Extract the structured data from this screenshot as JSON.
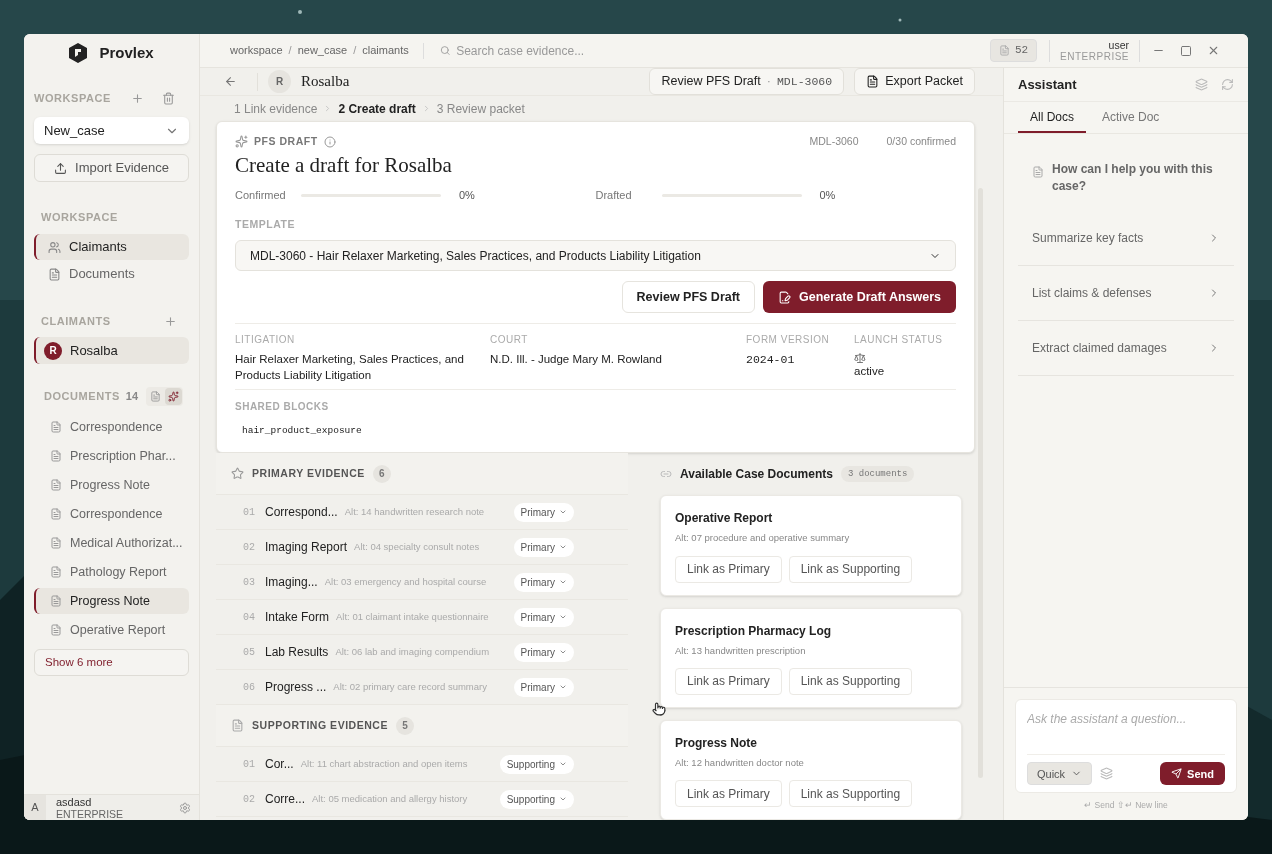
{
  "app": {
    "name": "Provlex"
  },
  "sidebar": {
    "workspace_heading": "WORKSPACE",
    "workspace_select": "New_case",
    "import_button": "Import Evidence",
    "nav_heading": "WORKSPACE",
    "nav": [
      {
        "label": "Claimants",
        "kind": "users",
        "selected": true
      },
      {
        "label": "Documents",
        "kind": "document",
        "selected": false
      }
    ],
    "claimants_heading": "CLAIMANTS",
    "claimants": [
      {
        "initial": "R",
        "name": "Rosalba",
        "selected": true
      }
    ],
    "documents_heading": "DOCUMENTS",
    "documents_count": "14",
    "view_modes": [
      {
        "kind": "list",
        "selected": false
      },
      {
        "kind": "graph",
        "selected": true
      }
    ],
    "documents": [
      {
        "label": "Correspondence",
        "selected": false
      },
      {
        "label": "Prescription Phar...",
        "selected": false
      },
      {
        "label": "Progress Note",
        "selected": false
      },
      {
        "label": "Correspondence",
        "selected": false
      },
      {
        "label": "Medical Authorizat...",
        "selected": false
      },
      {
        "label": "Pathology Report",
        "selected": false
      },
      {
        "label": "Progress Note",
        "selected": true
      },
      {
        "label": "Operative Report",
        "selected": false
      }
    ],
    "show_more": "Show 6 more",
    "user": {
      "initial": "A",
      "name": "asdasd",
      "plan": "ENTERPRISE"
    }
  },
  "topbar": {
    "breadcrumbs": [
      "workspace",
      "new_case",
      "claimants"
    ],
    "separator": "/",
    "search_placeholder": "Search case evidence...",
    "doc_count": "52",
    "user": "user",
    "plan": "ENTERPRISE"
  },
  "header": {
    "avatar": "R",
    "name": "Rosalba",
    "review_button": "Review PFS Draft",
    "review_separator": "·",
    "review_code": "MDL-3060",
    "export_button": "Export Packet"
  },
  "steps": [
    {
      "label": "1 Link evidence",
      "selected": false
    },
    {
      "label": "2 Create draft",
      "selected": true
    },
    {
      "label": "3 Review packet",
      "selected": false
    }
  ],
  "draft": {
    "eyebrow": "PFS DRAFT",
    "code": "MDL-3060",
    "confirmed_count": "0/30 confirmed",
    "title": "Create a draft for Rosalba",
    "progress": [
      {
        "label": "Confirmed",
        "level": 0,
        "reading": "0%"
      },
      {
        "label": "Drafted",
        "level": 0,
        "reading": "0%"
      }
    ],
    "template_label": "TEMPLATE",
    "template_value": "MDL-3060 - Hair Relaxer Marketing, Sales Practices, and Products Liability Litigation",
    "review_button": "Review PFS Draft",
    "generate_button": "Generate Draft Answers",
    "meta": [
      {
        "label": "LITIGATION",
        "value": "Hair Relaxer Marketing, Sales Practices, and Products Liability Litigation",
        "kind": "text"
      },
      {
        "label": "COURT",
        "value": "N.D. Ill. - Judge Mary M. Rowland",
        "kind": "text"
      },
      {
        "label": "FORM VERSION",
        "value": "2024-01",
        "kind": "code"
      },
      {
        "label": "LAUNCH STATUS",
        "value": "active",
        "kind": "status"
      }
    ],
    "shared_label": "SHARED BLOCKS",
    "shared_blocks": [
      "hair_product_exposure"
    ]
  },
  "evidence": [
    {
      "kind": "primary",
      "title": "PRIMARY EVIDENCE",
      "count": "6",
      "rows": [
        {
          "num": "01",
          "title": "Correspond...",
          "alt": "Alt: 14 handwritten research note",
          "tag": "Primary"
        },
        {
          "num": "02",
          "title": "Imaging Report",
          "alt": "Alt: 04 specialty consult notes",
          "tag": "Primary"
        },
        {
          "num": "03",
          "title": "Imaging...",
          "alt": "Alt: 03 emergency and hospital course",
          "tag": "Primary"
        },
        {
          "num": "04",
          "title": "Intake Form",
          "alt": "Alt: 01 claimant intake questionnaire",
          "tag": "Primary"
        },
        {
          "num": "05",
          "title": "Lab Results",
          "alt": "Alt: 06 lab and imaging compendium",
          "tag": "Primary"
        },
        {
          "num": "06",
          "title": "Progress ...",
          "alt": "Alt: 02 primary care record summary",
          "tag": "Primary"
        }
      ]
    },
    {
      "kind": "supporting",
      "title": "SUPPORTING EVIDENCE",
      "count": "5",
      "rows": [
        {
          "num": "01",
          "title": "Cor...",
          "alt": "Alt: 11 chart abstraction and open items",
          "tag": "Supporting"
        },
        {
          "num": "02",
          "title": "Corre...",
          "alt": "Alt: 05 medication and allergy history",
          "tag": "Supporting"
        }
      ]
    }
  ],
  "available": {
    "title": "Available Case Documents",
    "count": "3 documents",
    "documents": [
      {
        "name": "Operative Report",
        "alt": "Alt: 07 procedure and operative summary",
        "actions": [
          "Link as Primary",
          "Link as Supporting"
        ]
      },
      {
        "name": "Prescription Pharmacy Log",
        "alt": "Alt: 13 handwritten prescription",
        "actions": [
          "Link as Primary",
          "Link as Supporting"
        ]
      },
      {
        "name": "Progress Note",
        "alt": "Alt: 12 handwritten doctor note",
        "actions": [
          "Link as Primary",
          "Link as Supporting"
        ]
      }
    ]
  },
  "assistant": {
    "title": "Assistant",
    "tabs": [
      {
        "label": "All Docs",
        "selected": true
      },
      {
        "label": "Active Doc",
        "selected": false
      }
    ],
    "prompt": "How can I help you with this case?",
    "suggestions": [
      "Summarize key facts",
      "List claims & defenses",
      "Extract claimed damages"
    ],
    "input_placeholder": "Ask the assistant a question...",
    "mode": "Quick",
    "send_button": "Send",
    "hint": "↵ Send ⇧↵ New line"
  }
}
